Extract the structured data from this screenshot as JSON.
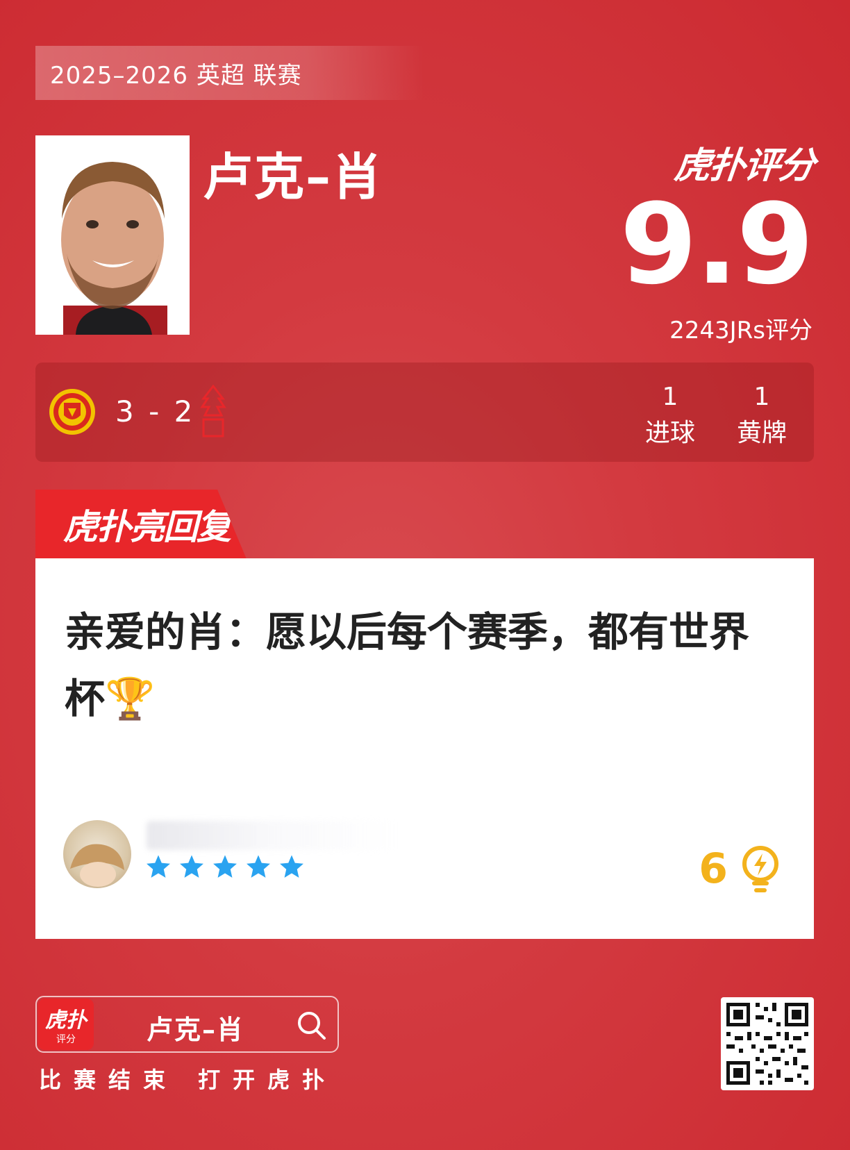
{
  "header": {
    "season": "2025–2026 英超 联赛"
  },
  "player": {
    "name": "卢克–肖"
  },
  "rating": {
    "brand": "虎扑评分",
    "score": "9.9",
    "voters": "2243JRs评分"
  },
  "match": {
    "score": "3 - 2",
    "stats": [
      {
        "value": "1",
        "label": "进球"
      },
      {
        "value": "1",
        "label": "黄牌"
      }
    ]
  },
  "reply": {
    "tab_label": "虎扑亮回复",
    "text": "亲爱的肖：愿以后每个赛季，都有世界杯🏆",
    "stars": 5,
    "light_count": "6"
  },
  "footer": {
    "app_icon_text": "虎扑",
    "app_icon_sub": "评分",
    "search_term": "卢克–肖",
    "caption": "比赛结束 打开虎扑"
  },
  "colors": {
    "background": "#d33a40",
    "accent_red": "#e8262a",
    "star_blue": "#2aa3f0",
    "bulb_gold": "#f3b21c"
  }
}
